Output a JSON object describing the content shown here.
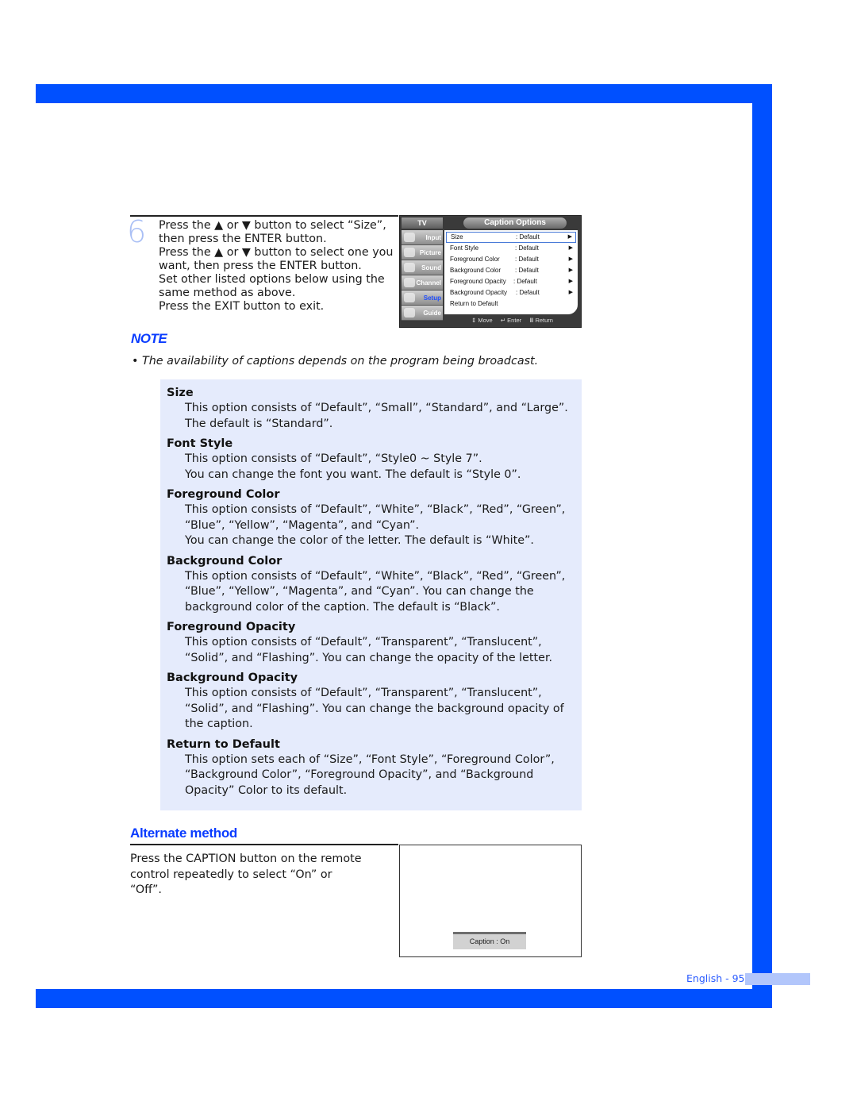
{
  "colors": {
    "frame": "#0050ff",
    "accent_text": "#0a3cff",
    "options_bg": "#e5ebfc",
    "step_number": "#a9bff5"
  },
  "step": {
    "number": "6",
    "lines": [
      "Press the ▲ or ▼ button to select “Size”,",
      "then press the ENTER button.",
      "Press the ▲ or ▼ button to select one you",
      "want, then press the ENTER button.",
      "Set other listed options below using the",
      "same method as above.",
      "Press the EXIT button to exit."
    ]
  },
  "osd": {
    "tv_label": "TV",
    "title": "Caption Options",
    "sidebar": [
      {
        "label": "Input",
        "icon": "input-icon",
        "active": false
      },
      {
        "label": "Picture",
        "icon": "picture-icon",
        "active": false
      },
      {
        "label": "Sound",
        "icon": "sound-icon",
        "active": false
      },
      {
        "label": "Channel",
        "icon": "channel-icon",
        "active": false
      },
      {
        "label": "Setup",
        "icon": "setup-icon",
        "active": true
      },
      {
        "label": "Guide",
        "icon": "guide-icon",
        "active": false
      }
    ],
    "rows": [
      {
        "label": "Size",
        "value": ": Default",
        "arrow": "▶",
        "selected": true
      },
      {
        "label": "Font Style",
        "value": ": Default",
        "arrow": "▶",
        "selected": false
      },
      {
        "label": "Foreground Color",
        "value": ": Default",
        "arrow": "▶",
        "selected": false
      },
      {
        "label": "Background Color",
        "value": ": Default",
        "arrow": "▶",
        "selected": false
      },
      {
        "label": "Foreground Opacity",
        "value": ": Default",
        "arrow": "▶",
        "selected": false
      },
      {
        "label": "Background Opacity",
        "value": ": Default",
        "arrow": "▶",
        "selected": false
      },
      {
        "label": "Return to Default",
        "value": "",
        "arrow": "",
        "selected": false
      }
    ],
    "footer": {
      "move": "⇕ Move",
      "enter": "↵ Enter",
      "return": "Ⅲ Return"
    }
  },
  "note": {
    "heading": "NOTE",
    "text": "•  The availability of captions depends on the program being broadcast."
  },
  "options": [
    {
      "heading": "Size",
      "lines": [
        "This option consists of “Default”, “Small”, “Standard”, and “Large”.",
        "The default is “Standard”."
      ]
    },
    {
      "heading": "Font Style",
      "lines": [
        "This option consists of “Default”, “Style0 ~ Style 7”.",
        "You can change the font you want. The default is “Style 0”."
      ]
    },
    {
      "heading": "Foreground Color",
      "lines": [
        "This option consists of “Default”, “White”, “Black”, “Red”, “Green”,",
        "“Blue”, “Yellow”, “Magenta”, and “Cyan”.",
        "You can change the color of the letter. The default is “White”."
      ]
    },
    {
      "heading": "Background Color",
      "lines": [
        "This option consists of “Default”, “White”, “Black”, “Red”, “Green”,",
        "“Blue”, “Yellow”, “Magenta”, and “Cyan”. You can change the",
        "background color of the caption. The default is “Black”."
      ]
    },
    {
      "heading": "Foreground Opacity",
      "lines": [
        "This option consists of “Default”, “Transparent”, “Translucent”,",
        "“Solid”, and “Flashing”. You can change the opacity of the letter."
      ]
    },
    {
      "heading": "Background Opacity",
      "lines": [
        "This option consists of “Default”, “Transparent”, “Translucent”,",
        "“Solid”, and “Flashing”. You can change the background opacity of",
        "the caption."
      ]
    },
    {
      "heading": "Return to Default",
      "lines": [
        "This option sets each of “Size”, “Font Style”, “Foreground Color”,",
        "“Background Color”, “Foreground Opacity”, and “Background",
        "Opacity” Color to its default."
      ]
    }
  ],
  "alternate": {
    "heading": "Alternate method",
    "lines": [
      "Press the CAPTION button on the remote",
      "control repeatedly to select “On” or",
      "“Off”."
    ],
    "caption_osd": "Caption : On"
  },
  "footer": {
    "page": "English - 95"
  }
}
